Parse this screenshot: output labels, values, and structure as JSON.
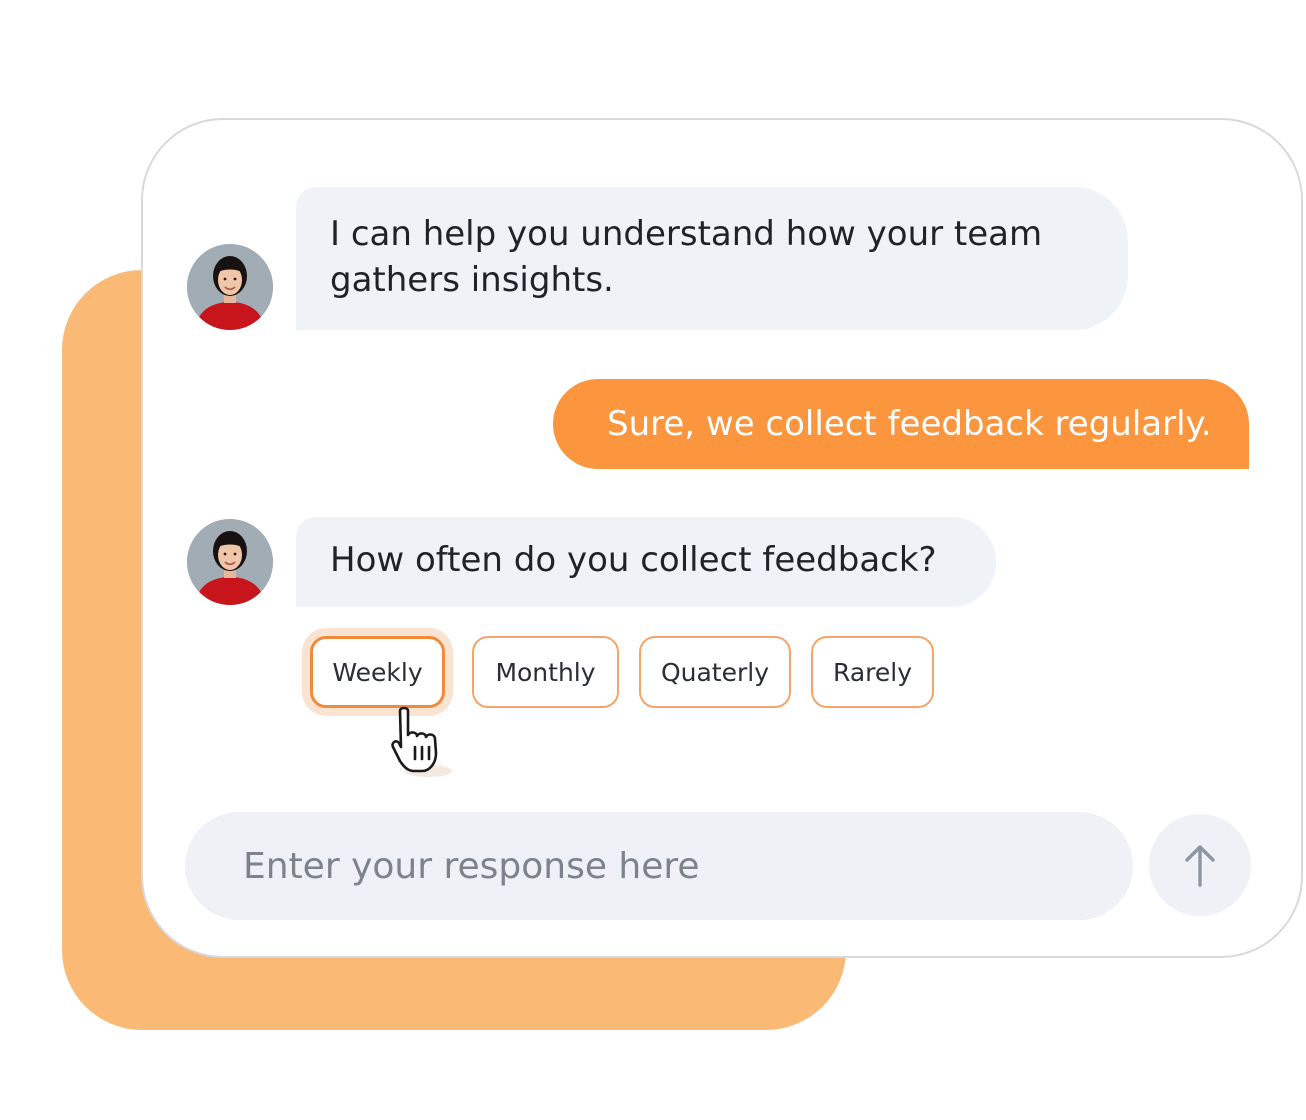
{
  "chat": {
    "messages": [
      {
        "sender": "bot",
        "text_line1": "I can help you understand how your team",
        "text_line2": "gathers insights."
      },
      {
        "sender": "user",
        "text": "Sure, we collect feedback regularly."
      },
      {
        "sender": "bot",
        "text": "How often do you collect feedback?"
      }
    ],
    "options": [
      {
        "label": "Weekly",
        "selected": true
      },
      {
        "label": "Monthly",
        "selected": false
      },
      {
        "label": "Quaterly",
        "selected": false
      },
      {
        "label": "Rarely",
        "selected": false
      }
    ]
  },
  "composer": {
    "placeholder": "Enter your response here",
    "send_icon": "arrow-up-icon"
  },
  "colors": {
    "accent": "#fb963f",
    "backdrop": "#fbb976",
    "bot_bubble": "#eff2f7",
    "option_border": "#f5a56a"
  }
}
